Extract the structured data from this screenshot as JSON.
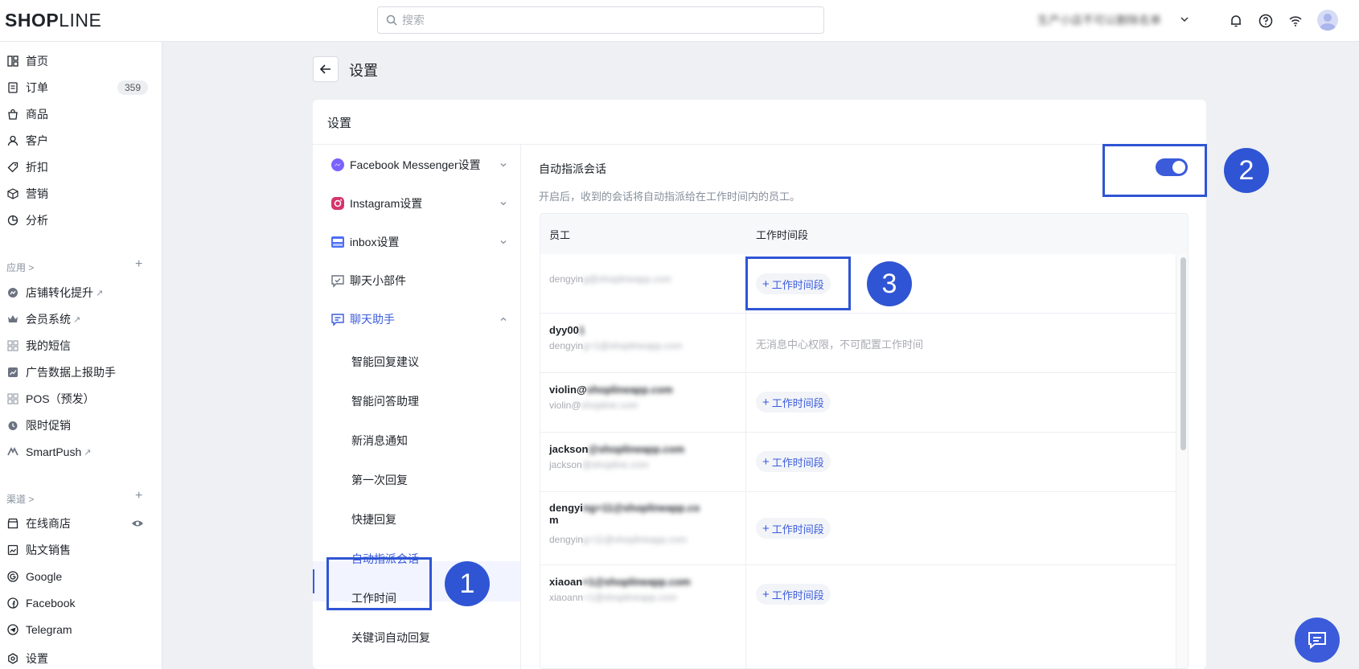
{
  "app": {
    "logo_bold": "SHOP",
    "logo_thin": "LINE",
    "search_placeholder": "搜索",
    "store_name": "生产小店不可以删除名单"
  },
  "sidebar": {
    "main_items": [
      {
        "label": "首页",
        "icon": "dashboard-icon"
      },
      {
        "label": "订单",
        "icon": "order-icon",
        "badge": "359"
      },
      {
        "label": "商品",
        "icon": "bag-icon"
      },
      {
        "label": "客户",
        "icon": "user-icon"
      },
      {
        "label": "折扣",
        "icon": "tag-icon"
      },
      {
        "label": "营销",
        "icon": "cube-icon"
      },
      {
        "label": "分析",
        "icon": "pie-icon"
      }
    ],
    "apps_label": "应用 >",
    "app_items": [
      {
        "label": "店铺转化提升",
        "icon": "growth-icon",
        "external": true
      },
      {
        "label": "会员系统",
        "icon": "crown-icon",
        "external": true
      },
      {
        "label": "我的短信",
        "icon": "grid-icon",
        "external": false
      },
      {
        "label": "广告数据上报助手",
        "icon": "chart-icon",
        "external": false
      },
      {
        "label": "POS（预发）",
        "icon": "grid-icon",
        "external": false
      },
      {
        "label": "限时促销",
        "icon": "timer-icon",
        "external": false
      },
      {
        "label": "SmartPush",
        "icon": "smartpush-icon",
        "external": true
      }
    ],
    "channels_label": "渠道 >",
    "channel_items": [
      {
        "label": "在线商店",
        "icon": "store-icon"
      },
      {
        "label": "贴文销售",
        "icon": "post-icon"
      },
      {
        "label": "Google",
        "icon": "google-icon"
      },
      {
        "label": "Facebook",
        "icon": "facebook-icon"
      },
      {
        "label": "Telegram",
        "icon": "telegram-icon"
      }
    ],
    "settings_label": "设置"
  },
  "page": {
    "title": "设置",
    "card_title": "设置"
  },
  "settings_menu": {
    "groups": [
      {
        "label": "Facebook Messenger设置",
        "icon": "messenger-icon"
      },
      {
        "label": "Instagram设置",
        "icon": "instagram-icon"
      },
      {
        "label": "inbox设置",
        "icon": "inbox-icon"
      },
      {
        "label": "聊天小部件",
        "icon": "chat-widget-icon"
      },
      {
        "label": "聊天助手",
        "icon": "chat-assistant-icon"
      }
    ],
    "sub_items": [
      "智能回复建议",
      "智能问答助理",
      "新消息通知",
      "第一次回复",
      "快捷回复",
      "自动指派会话",
      "工作时间",
      "关键词自动回复"
    ]
  },
  "auto_assign": {
    "title": "自动指派会话",
    "description": "开启后，收到的会话将自动指派给在工作时间内的员工。",
    "enabled": true,
    "col_employee": "员工",
    "col_hours": "工作时间段",
    "add_label": "工作时间段",
    "no_permission": "无消息中心权限，不可配置工作时间",
    "rows": [
      {
        "name": "",
        "name_hidden": "",
        "email": "dengyin",
        "email_hidden": "g@shoplineapp.com",
        "action": "add"
      },
      {
        "name": "dyy00",
        "name_hidden": "1",
        "email": "dengyin",
        "email_hidden": "g+1@shoplineapp.com",
        "action": "none"
      },
      {
        "name": "violin@",
        "name_hidden": "shoplineapp.com",
        "email": "violin@",
        "email_hidden": "shopline.com",
        "action": "add"
      },
      {
        "name": "jackson",
        "name_hidden": "@shoplineapp.com",
        "email": "jackson",
        "email_hidden": "@shopline.com",
        "action": "add"
      },
      {
        "name": "dengyi",
        "name_hidden": "ng+11@shoplineapp.co",
        "name_line2": "m",
        "email": "dengyin",
        "email_hidden": "g+11@shoplineapp.com",
        "action": "add"
      },
      {
        "name": "xiaoan",
        "name_hidden": "+1@shoplineapp.com",
        "email": "xiaoann",
        "email_hidden": "+1@shoplineapp.com",
        "action": "add"
      }
    ]
  },
  "annotations": [
    "1",
    "2",
    "3"
  ],
  "colors": {
    "accent": "#3b5bdb",
    "annotation": "#2f55d4"
  }
}
